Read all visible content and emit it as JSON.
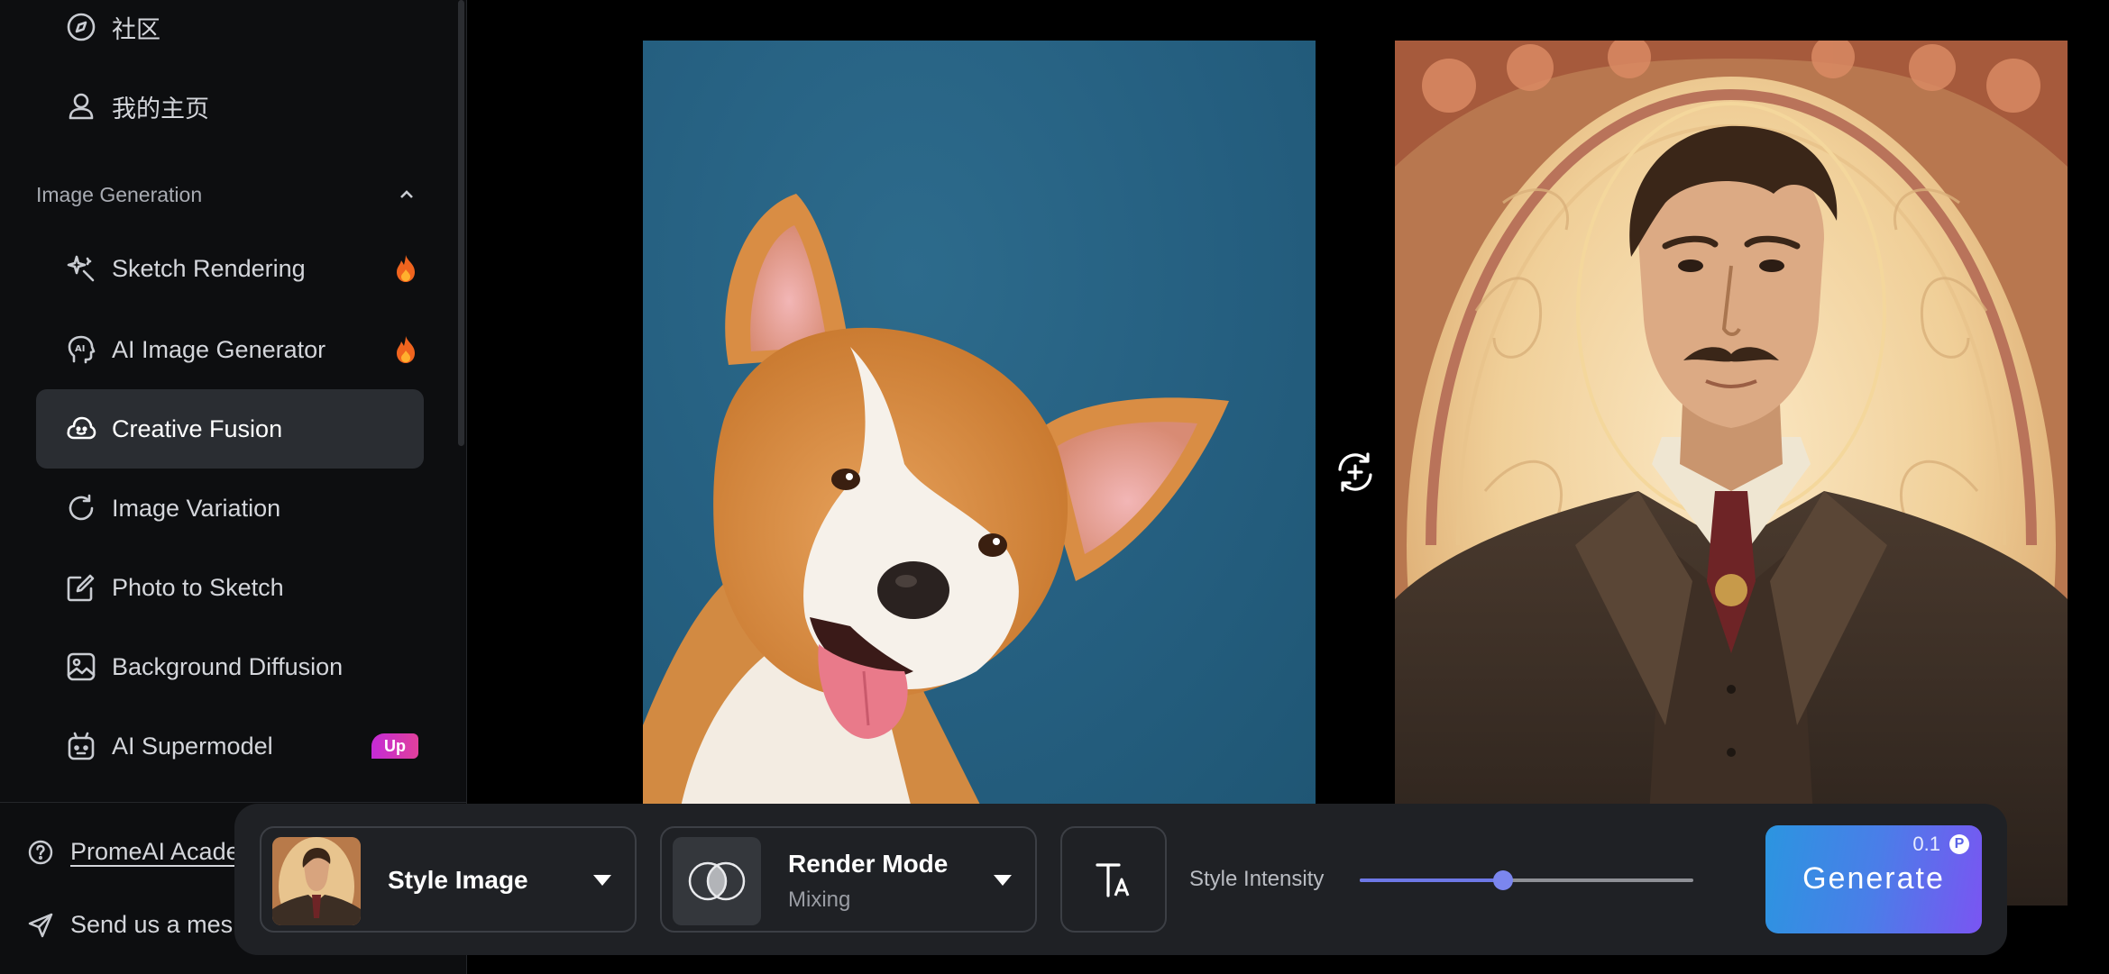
{
  "sidebar": {
    "top_items": [
      {
        "label": "社区",
        "icon": "compass-icon"
      },
      {
        "label": "我的主页",
        "icon": "user-icon"
      }
    ],
    "section": {
      "title": "Image Generation",
      "icon": "chevron-up-icon"
    },
    "items": [
      {
        "label": "Sketch Rendering",
        "icon": "sparkle-icon",
        "badge": "flame-icon"
      },
      {
        "label": "AI Image Generator",
        "icon": "ai-head-icon",
        "badge": "flame-icon"
      },
      {
        "label": "Creative Fusion",
        "icon": "cloud-face-icon",
        "active": true
      },
      {
        "label": "Image Variation",
        "icon": "refresh-icon"
      },
      {
        "label": "Photo to Sketch",
        "icon": "edit-icon"
      },
      {
        "label": "Background Diffusion",
        "icon": "image-icon"
      },
      {
        "label": "AI Supermodel",
        "icon": "robot-icon",
        "badge_text": "Up"
      }
    ],
    "footer": [
      {
        "label": "PromeAI Acade",
        "icon": "help-circle-icon"
      },
      {
        "label": "Send us a mes",
        "icon": "send-icon"
      }
    ]
  },
  "canvas": {
    "left_image": "corgi-photo",
    "right_image": "art-nouveau-gentleman",
    "swap_icon": "swap-rotate-icon"
  },
  "toolbar": {
    "style_image": {
      "label": "Style Image"
    },
    "render_mode": {
      "label": "Render Mode",
      "value": "Mixing"
    },
    "text_icon": "text-format-icon",
    "intensity": {
      "label": "Style Intensity",
      "value": 0.43
    },
    "generate": {
      "label": "Generate",
      "cost": "0.1"
    }
  },
  "colors": {
    "accent_start": "#2b95e0",
    "accent_end": "#7a55f2",
    "active_item_bg": "#2a2d32",
    "up_badge": "#d838b8"
  }
}
